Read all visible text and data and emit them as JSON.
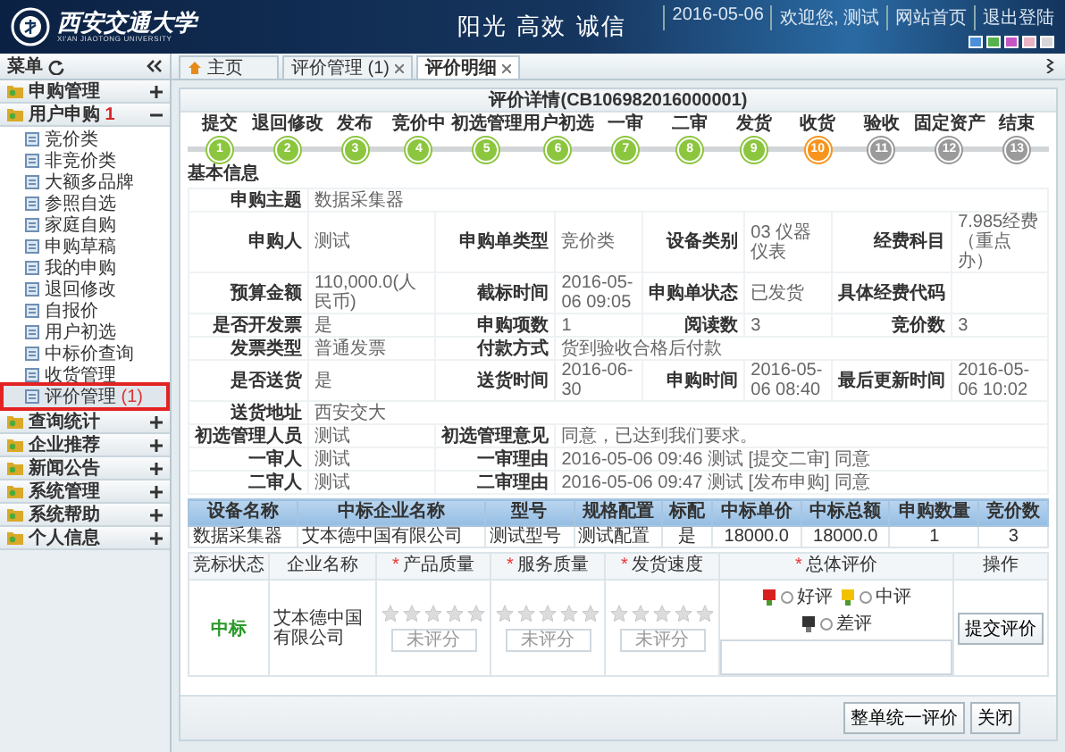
{
  "header": {
    "logo_text": "西安交通大学",
    "logo_subtext": "XI'AN JIAOTONG UNIVERSITY",
    "slogan": "阳光 高效 诚信",
    "links": [
      "2016-05-06",
      "欢迎您, 测试",
      "网站首页",
      "退出登陆"
    ]
  },
  "sidebar": {
    "title": "菜单",
    "groups": [
      {
        "label": "申购管理",
        "expanded": false
      },
      {
        "label": "用户申购",
        "badge": "1",
        "expanded": true,
        "children": [
          {
            "label": "竞价类",
            "selected": false
          },
          {
            "label": "非竞价类",
            "selected": false
          },
          {
            "label": "大额多品牌",
            "selected": false
          },
          {
            "label": "参照自选",
            "selected": false
          },
          {
            "label": "家庭自购",
            "selected": false
          },
          {
            "label": "申购草稿",
            "selected": false
          },
          {
            "label": "我的申购",
            "selected": false
          },
          {
            "label": "退回修改",
            "selected": false
          },
          {
            "label": "自报价",
            "selected": false
          },
          {
            "label": "用户初选",
            "selected": false
          },
          {
            "label": "中标价查询",
            "selected": false
          },
          {
            "label": "收货管理",
            "selected": false
          },
          {
            "label": "评价管理",
            "count": "(1)",
            "selected": true
          }
        ]
      },
      {
        "label": "查询统计",
        "expanded": false
      },
      {
        "label": "企业推荐",
        "expanded": false
      },
      {
        "label": "新闻公告",
        "expanded": false
      },
      {
        "label": "系统管理",
        "expanded": false
      },
      {
        "label": "系统帮助",
        "expanded": false
      },
      {
        "label": "个人信息",
        "expanded": false
      }
    ]
  },
  "tabs": [
    {
      "label": "主页",
      "kind": "home",
      "selected": false
    },
    {
      "label": "评价管理 (1)",
      "kind": "closable",
      "selected": false
    },
    {
      "label": "评价明细",
      "kind": "closable",
      "selected": true
    }
  ],
  "panel": {
    "title": "评价详情(CB106982016000001)",
    "steps": [
      {
        "label": "提交",
        "number": "1",
        "done": true,
        "current": false
      },
      {
        "label": "退回修改",
        "number": "2",
        "done": true,
        "current": false
      },
      {
        "label": "发布",
        "number": "3",
        "done": true,
        "current": false
      },
      {
        "label": "竞价中",
        "number": "4",
        "done": true,
        "current": false
      },
      {
        "label": "初选管理",
        "number": "5",
        "done": true,
        "current": false
      },
      {
        "label": "用户初选",
        "number": "6",
        "done": true,
        "current": false
      },
      {
        "label": "一审",
        "number": "7",
        "done": true,
        "current": false
      },
      {
        "label": "二审",
        "number": "8",
        "done": true,
        "current": false
      },
      {
        "label": "发货",
        "number": "9",
        "done": true,
        "current": false
      },
      {
        "label": "收货",
        "number": "10",
        "done": false,
        "current": true
      },
      {
        "label": "验收",
        "number": "11",
        "done": false,
        "current": false
      },
      {
        "label": "固定资产",
        "number": "12",
        "done": false,
        "current": false
      },
      {
        "label": "结束",
        "number": "13",
        "done": false,
        "current": false
      }
    ],
    "section_title": "基本信息",
    "info_rows": [
      [
        {
          "label": "申购主题",
          "value": "数据采集器"
        }
      ],
      [
        {
          "label": "申购人",
          "value": "测试"
        },
        {
          "label": "申购单类型",
          "value": "竞价类"
        },
        {
          "label": "设备类别",
          "value": "03 仪器仪表"
        },
        {
          "label": "经费科目",
          "value": "7.985经费（重点办）"
        }
      ],
      [
        {
          "label": "预算金额",
          "value": "110,000.0(人民币)"
        },
        {
          "label": "截标时间",
          "value": "2016-05-06 09:05"
        },
        {
          "label": "申购单状态",
          "value": "已发货"
        },
        {
          "label": "具体经费代码"
        }
      ],
      [
        {
          "label": "是否开发票",
          "value": "是"
        },
        {
          "label": "申购项数",
          "value": "1"
        },
        {
          "label": "阅读数",
          "value": "3"
        },
        {
          "label": "竞价数",
          "value": "3"
        }
      ],
      [
        {
          "label": "发票类型",
          "value": "普通发票"
        },
        {
          "label": "付款方式",
          "value": "货到验收合格后付款"
        }
      ],
      [
        {
          "label": "是否送货",
          "value": "是"
        },
        {
          "label": "送货时间",
          "value": "2016-06-30"
        },
        {
          "label": "申购时间",
          "value": "2016-05-06 08:40"
        },
        {
          "label": "最后更新时间",
          "value": "2016-05-06 10:02"
        }
      ],
      [
        {
          "label": "送货地址",
          "value": "西安交大"
        }
      ],
      [
        {
          "label": "初选管理人员",
          "value": "测试"
        },
        {
          "label": "初选管理意见",
          "value": "同意，已达到我们要求。"
        }
      ],
      [
        {
          "label": "一审人",
          "value": "测试"
        },
        {
          "label": "一审理由",
          "value": "2016-05-06 09:46 测试 [提交二审] 同意"
        }
      ],
      [
        {
          "label": "二审人",
          "value": "测试"
        },
        {
          "label": "二审理由",
          "value": "2016-05-06 09:47 测试 [发布申购] 同意"
        }
      ]
    ],
    "items_table": {
      "columns": [
        "设备名称",
        "中标企业名称",
        "型号",
        "规格配置",
        "标配",
        "中标单价",
        "中标总额",
        "申购数量",
        "竞价数"
      ],
      "rows": [
        [
          "数据采集器",
          "艾本德中国有限公司",
          "测试型号",
          "测试配置",
          "是",
          "18000.0",
          "18000.0",
          "1",
          "3"
        ]
      ]
    },
    "review_table": {
      "columns": [
        {
          "label": "竞标状态"
        },
        {
          "label": "企业名称"
        },
        {
          "label": "产品质量",
          "required_mark": "*"
        },
        {
          "label": "服务质量",
          "required_mark": "*"
        },
        {
          "label": "发货速度",
          "required_mark": "*"
        },
        {
          "label": "总体评价",
          "required_mark": "*"
        },
        {
          "label": "操作"
        }
      ],
      "row": {
        "status": "中标",
        "company": "艾本德中国有限公司",
        "ratings": [
          {
            "stars": 0,
            "button": "未评分"
          },
          {
            "stars": 0,
            "button": "未评分"
          },
          {
            "stars": 0,
            "button": "未评分"
          }
        ],
        "overall": [
          {
            "label": "好评",
            "kind": "good",
            "selected": false
          },
          {
            "label": "中评",
            "kind": "neutral",
            "selected": false
          },
          {
            "label": "差评",
            "kind": "bad",
            "selected": false
          }
        ],
        "action": "提交评价"
      }
    },
    "footer_buttons": [
      "整单统一评价",
      "关闭"
    ]
  }
}
